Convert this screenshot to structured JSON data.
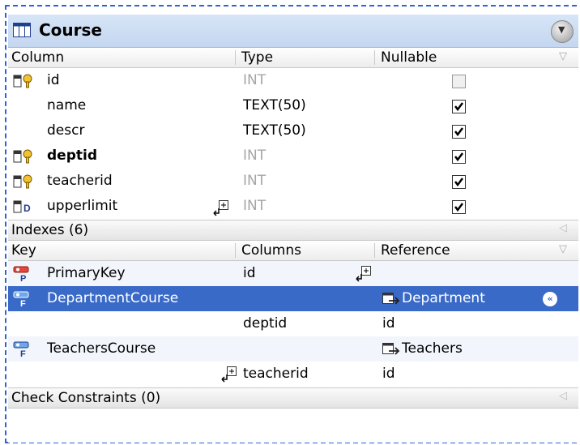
{
  "table": {
    "title": "Course",
    "columns_header": {
      "column": "Column",
      "type": "Type",
      "nullable": "Nullable"
    },
    "columns": [
      {
        "name": "id",
        "type": "INT",
        "type_style": "grey",
        "name_style": "normal",
        "nullable": false,
        "icon": "primary-key-icon"
      },
      {
        "name": "name",
        "type": "TEXT(50)",
        "type_style": "normal",
        "name_style": "normal",
        "nullable": true,
        "icon": ""
      },
      {
        "name": "descr",
        "type": "TEXT(50)",
        "type_style": "normal",
        "name_style": "normal",
        "nullable": true,
        "icon": ""
      },
      {
        "name": "deptid",
        "type": "INT",
        "type_style": "grey",
        "name_style": "bold",
        "nullable": true,
        "icon": "foreign-key-icon"
      },
      {
        "name": "teacherid",
        "type": "INT",
        "type_style": "grey",
        "name_style": "normal",
        "nullable": true,
        "icon": "foreign-key-icon"
      },
      {
        "name": "upperlimit",
        "type": "INT",
        "type_style": "grey",
        "name_style": "normal",
        "nullable": true,
        "icon": "default-column-icon"
      }
    ],
    "indexes_section": "Indexes (6)",
    "keys_header": {
      "key": "Key",
      "columns": "Columns",
      "reference": "Reference"
    },
    "keys": [
      {
        "key": "PrimaryKey",
        "columns": "id",
        "reference": "",
        "key_type": "primary",
        "selected": false
      },
      {
        "key": "DepartmentCourse",
        "columns": "",
        "reference": "Department",
        "key_type": "foreign",
        "selected": true
      },
      {
        "key": "",
        "columns": "deptid",
        "reference": "id",
        "key_type": "",
        "selected": false
      },
      {
        "key": "TeachersCourse",
        "columns": "",
        "reference": "Teachers",
        "key_type": "foreign",
        "selected": false
      },
      {
        "key": "",
        "columns": "teacherid",
        "reference": "id",
        "key_type": "",
        "selected": false
      }
    ],
    "check_section": "Check Constraints (0)"
  }
}
